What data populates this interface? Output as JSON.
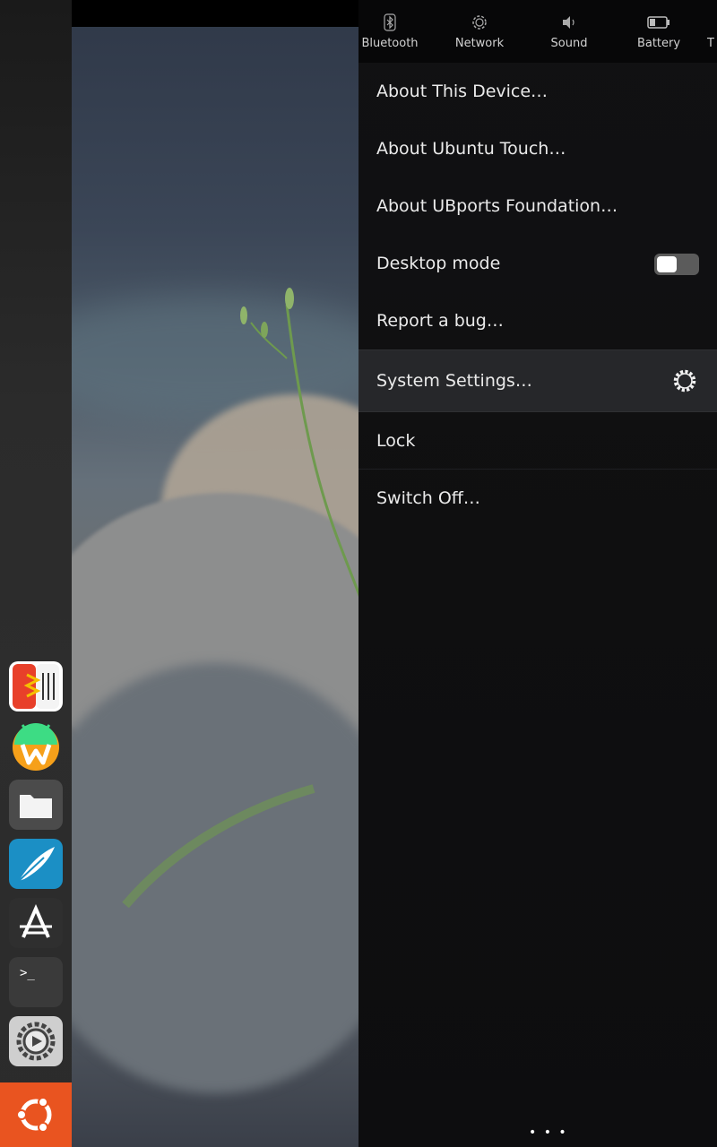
{
  "indicators": [
    {
      "label": "Bluetooth",
      "icon": "bluetooth-icon"
    },
    {
      "label": "Network",
      "icon": "network-icon"
    },
    {
      "label": "Sound",
      "icon": "sound-icon"
    },
    {
      "label": "Battery",
      "icon": "battery-icon"
    },
    {
      "label": "T",
      "icon": ""
    }
  ],
  "menu": {
    "about_device": "About This Device…",
    "about_ubuntu": "About Ubuntu Touch…",
    "about_ubports": "About UBports Foundation…",
    "desktop_mode": "Desktop mode",
    "desktop_mode_on": false,
    "report_bug": "Report a bug…",
    "system_settings": "System Settings…",
    "lock": "Lock",
    "switch_off": "Switch Off…"
  },
  "launcher": {
    "apps": [
      "music-app-icon",
      "waydroid-icon",
      "files-icon",
      "feather-app-icon",
      "app-store-icon",
      "terminal-icon",
      "settings-app-icon"
    ],
    "terminal_glyph": ">_",
    "home_icon": "ubuntu-logo-icon"
  },
  "more_glyph": "• • •",
  "colors": {
    "accent": "#e95420",
    "panel_bg": "#111113",
    "selected_row": "#26272a"
  }
}
